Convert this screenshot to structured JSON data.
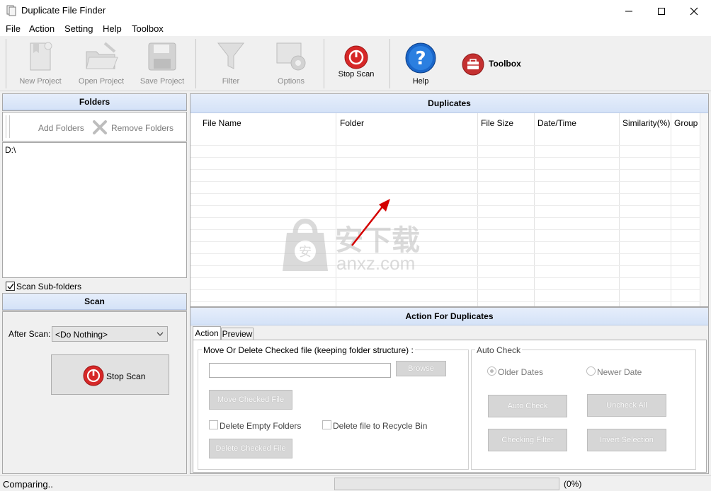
{
  "window": {
    "title": "Duplicate File Finder"
  },
  "menu": [
    "File",
    "Action",
    "Setting",
    "Help",
    "Toolbox"
  ],
  "toolbar": {
    "new_project": "New Project",
    "open_project": "Open Project",
    "save_project": "Save Project",
    "filter": "Filter",
    "options": "Options",
    "stop_scan": "Stop Scan",
    "help": "Help",
    "toolbox": "Toolbox"
  },
  "folders": {
    "header": "Folders",
    "add": "Add Folders",
    "remove": "Remove Folders",
    "items": [
      "D:\\"
    ],
    "scan_subfolders": "Scan Sub-folders",
    "scan_subfolders_checked": true
  },
  "scan": {
    "header": "Scan",
    "after_scan_label": "After Scan:",
    "after_scan_value": "<Do Nothing>",
    "stop_button": "Stop Scan"
  },
  "duplicates": {
    "header": "Duplicates",
    "columns": [
      "File Name",
      "Folder",
      "File Size",
      "Date/Time",
      "Similarity(%)",
      "Group"
    ]
  },
  "watermark": {
    "text": "安下载",
    "sub": "anxz.com"
  },
  "actions": {
    "header": "Action For Duplicates",
    "tabs": [
      "Action",
      "Preview"
    ],
    "move_group": "Move Or Delete Checked file (keeping folder structure) :",
    "browse": "Browse",
    "move_checked": "Move Checked File",
    "delete_empty": "Delete Empty Folders",
    "recycle": "Delete file to Recycle Bin",
    "delete_checked": "Delete Checked File",
    "auto_check_group": "Auto Check",
    "older_dates": "Older Dates",
    "newer_date": "Newer Date",
    "auto_check": "Auto Check",
    "uncheck_all": "Uncheck All",
    "checking_filter": "Checking Filter",
    "invert_selection": "Invert Selection"
  },
  "status": {
    "text": "Comparing..",
    "progress_text": "(0%)",
    "progress": 0
  },
  "colors": {
    "stop_red": "#d62828",
    "help_blue": "#1a66c9",
    "header_bg": "#dbe6f8",
    "arrow_red": "#d40000"
  }
}
